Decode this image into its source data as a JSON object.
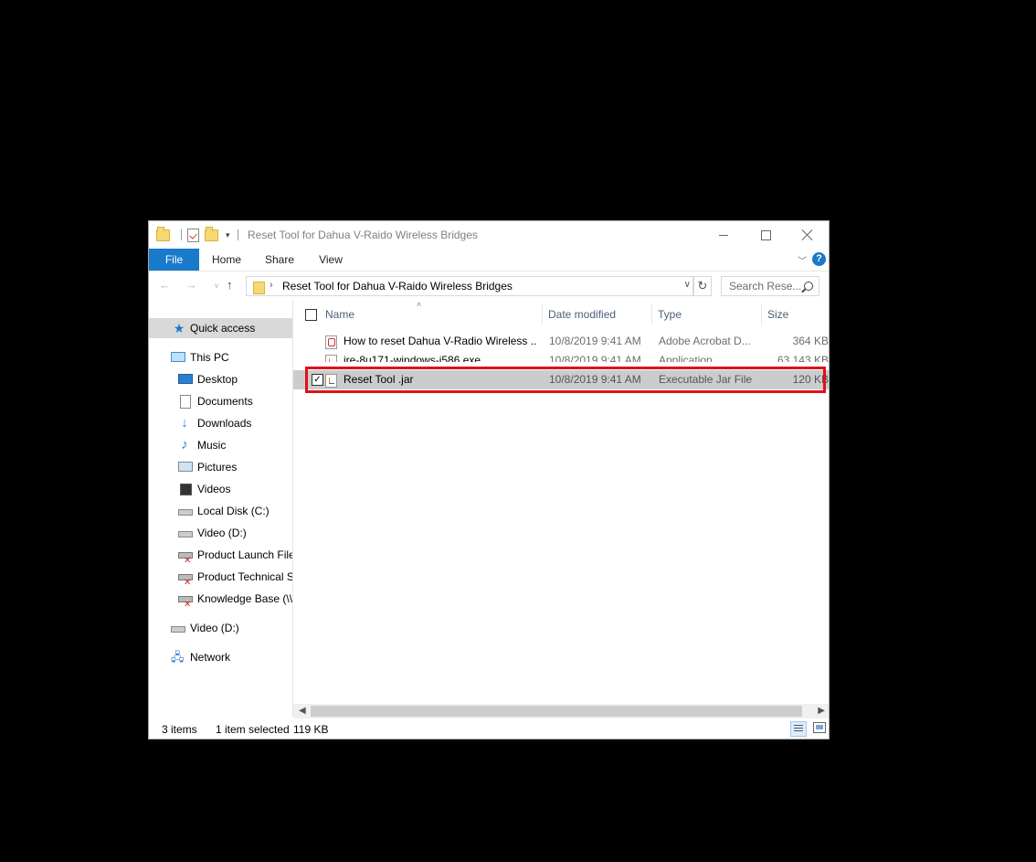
{
  "window": {
    "title": "Reset Tool for Dahua V-Raido Wireless Bridges"
  },
  "ribbon": {
    "tabs": [
      "File",
      "Home",
      "Share",
      "View"
    ],
    "help": "?"
  },
  "address": {
    "path": "Reset Tool for Dahua V-Raido Wireless Bridges"
  },
  "search": {
    "placeholder": "Search Rese..."
  },
  "navigation": {
    "quick_access": "Quick access",
    "this_pc": "This PC",
    "items": [
      {
        "label": "Desktop",
        "icon": "desktop-icon"
      },
      {
        "label": "Documents",
        "icon": "documents-icon"
      },
      {
        "label": "Downloads",
        "icon": "downloads-icon"
      },
      {
        "label": "Music",
        "icon": "music-icon"
      },
      {
        "label": "Pictures",
        "icon": "pictures-icon"
      },
      {
        "label": "Videos",
        "icon": "videos-icon"
      },
      {
        "label": "Local Disk (C:)",
        "icon": "disk-icon"
      },
      {
        "label": "Video (D:)",
        "icon": "disk-icon"
      },
      {
        "label": "Product Launch File",
        "icon": "network-drive-disconnected-icon"
      },
      {
        "label": "Product Technical S",
        "icon": "network-drive-disconnected-icon"
      },
      {
        "label": "Knowledge Base (\\\\",
        "icon": "network-drive-disconnected-icon"
      }
    ],
    "video_drive": "Video (D:)",
    "network": "Network"
  },
  "columns": {
    "name": "Name",
    "date": "Date modified",
    "type": "Type",
    "size": "Size"
  },
  "files": [
    {
      "name": "How to reset Dahua V-Radio Wireless ...",
      "date": "10/8/2019 9:41 AM",
      "type": "Adobe Acrobat D...",
      "size": "364 KB",
      "icon": "pdf-icon"
    },
    {
      "name": "jre-8u171-windows-i586.exe",
      "date": "10/8/2019 9:41 AM",
      "type": "Application",
      "size": "63,143 KB",
      "icon": "java-icon"
    },
    {
      "name": "Reset Tool .jar",
      "date": "10/8/2019 9:41 AM",
      "type": "Executable Jar File",
      "size": "120 KB",
      "icon": "java-icon",
      "selected": true
    }
  ],
  "status": {
    "items": "3 items",
    "selected": "1 item selected",
    "size": "119 KB"
  },
  "colors": {
    "accent": "#1979ca",
    "highlight": "#e0111b"
  }
}
